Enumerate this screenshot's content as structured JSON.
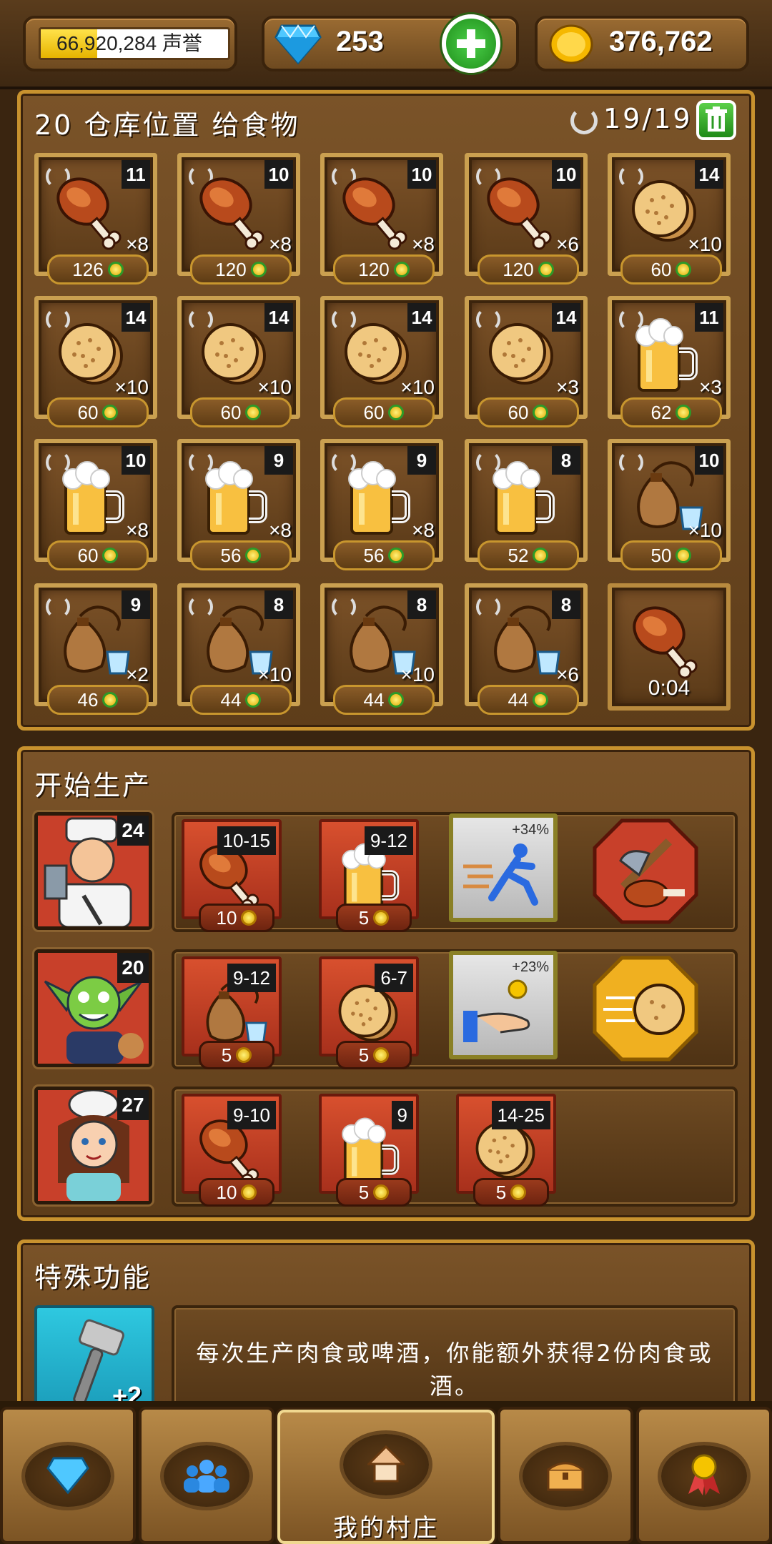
{
  "header": {
    "reputation": "66,920,284 声誉",
    "reputation_fill": 0.3,
    "gems": "253",
    "gold": "376,762"
  },
  "warehouse": {
    "title": "20 仓库位置 给食物",
    "capacity": "19/19",
    "items": [
      {
        "food": "meat",
        "level": "11",
        "qty": "×8",
        "price": "126"
      },
      {
        "food": "meat",
        "level": "10",
        "qty": "×8",
        "price": "120"
      },
      {
        "food": "meat",
        "level": "10",
        "qty": "×8",
        "price": "120"
      },
      {
        "food": "meat",
        "level": "10",
        "qty": "×6",
        "price": "120"
      },
      {
        "food": "cookie",
        "level": "14",
        "qty": "×10",
        "price": "60"
      },
      {
        "food": "cookie",
        "level": "14",
        "qty": "×10",
        "price": "60"
      },
      {
        "food": "cookie",
        "level": "14",
        "qty": "×10",
        "price": "60"
      },
      {
        "food": "cookie",
        "level": "14",
        "qty": "×10",
        "price": "60"
      },
      {
        "food": "cookie",
        "level": "14",
        "qty": "×3",
        "price": "60"
      },
      {
        "food": "beer",
        "level": "11",
        "qty": "×3",
        "price": "62"
      },
      {
        "food": "beer",
        "level": "10",
        "qty": "×8",
        "price": "60"
      },
      {
        "food": "beer",
        "level": "9",
        "qty": "×8",
        "price": "56"
      },
      {
        "food": "beer",
        "level": "9",
        "qty": "×8",
        "price": "56"
      },
      {
        "food": "beer",
        "level": "8",
        "qty": "",
        "price": "52"
      },
      {
        "food": "flask",
        "level": "10",
        "qty": "×10",
        "price": "50"
      },
      {
        "food": "flask",
        "level": "9",
        "qty": "×2",
        "price": "46"
      },
      {
        "food": "flask",
        "level": "8",
        "qty": "×10",
        "price": "44"
      },
      {
        "food": "flask",
        "level": "8",
        "qty": "×10",
        "price": "44"
      },
      {
        "food": "flask",
        "level": "8",
        "qty": "×6",
        "price": "44"
      }
    ],
    "producing": {
      "food": "meat",
      "timer": "0:04"
    }
  },
  "production": {
    "title": "开始生产",
    "workers": [
      {
        "name": "butcher",
        "level": "24",
        "products": [
          {
            "food": "meat",
            "range": "10-15",
            "price": "10"
          },
          {
            "food": "beer",
            "range": "9-12",
            "price": "5"
          }
        ],
        "boost": "+34%",
        "boost_icon": "running-man-icon",
        "special": "axe-meat-icon"
      },
      {
        "name": "goblin",
        "level": "20",
        "products": [
          {
            "food": "flask",
            "range": "9-12",
            "price": "5"
          },
          {
            "food": "cookie",
            "range": "6-7",
            "price": "5"
          }
        ],
        "boost": "+23%",
        "boost_icon": "hand-coin-icon",
        "special": "fast-cookie-icon"
      },
      {
        "name": "cook",
        "level": "27",
        "products": [
          {
            "food": "meat",
            "range": "9-10",
            "price": "10"
          },
          {
            "food": "beer",
            "range": "9",
            "price": "5"
          },
          {
            "food": "cookie",
            "range": "14-25",
            "price": "5"
          }
        ]
      }
    ]
  },
  "special": {
    "title": "特殊功能",
    "badge": "+2",
    "description": "每次生产肉食或啤酒，你能额外获得2份肉食或酒。"
  },
  "nav": {
    "village_label": "我的村庄",
    "items": [
      "gem-icon",
      "people-icon",
      "home-icon",
      "chest-icon",
      "medal-icon"
    ]
  },
  "colors": {
    "gold_border": "#c8922e",
    "wood": "#6e4a22",
    "product_red": "#c8402a"
  }
}
